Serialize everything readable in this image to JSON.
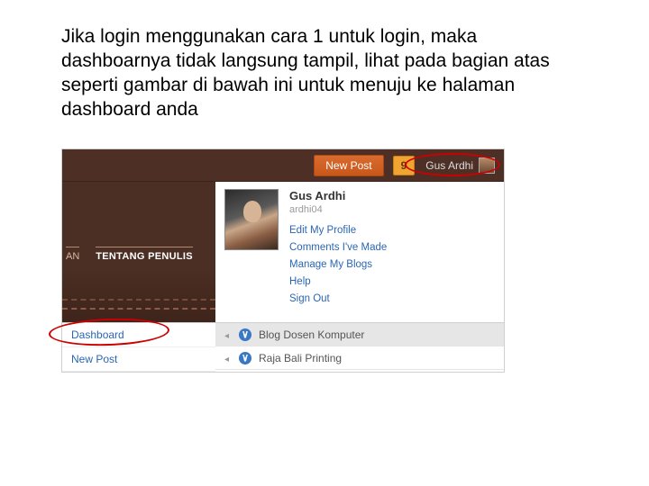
{
  "instruction": "Jika login menggunakan cara 1 untuk login, maka dashboarnya tidak langsung tampil, lihat pada bagian atas seperti gambar di bawah ini untuk menuju ke halaman dashboard anda",
  "topbar": {
    "newpost": "New Post",
    "notif": "9",
    "username": "Gus Ardhi"
  },
  "leftpane": {
    "tab1": "AN",
    "tab2": "TENTANG PENULIS"
  },
  "profile": {
    "name": "Gus Ardhi",
    "handle": "ardhi04"
  },
  "menu": {
    "edit": "Edit My Profile",
    "comments": "Comments I've Made",
    "manage": "Manage My Blogs",
    "help": "Help",
    "signout": "Sign Out"
  },
  "leftlinks": {
    "dashboard": "Dashboard",
    "newpost": "New Post"
  },
  "blogs": {
    "b1": "Blog Dosen Komputer",
    "b2": "Raja Bali Printing"
  }
}
